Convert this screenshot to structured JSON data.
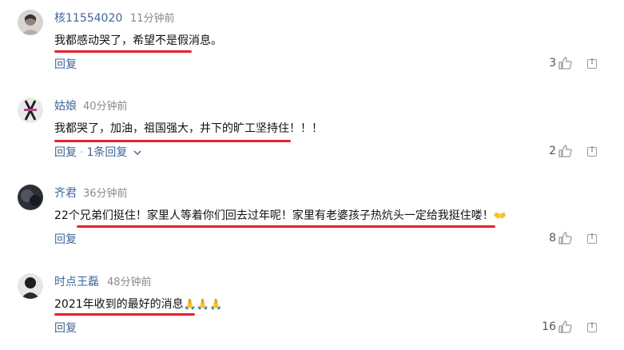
{
  "comments": [
    {
      "username": "核11554020",
      "time": "11分钟前",
      "text": "我都感动哭了，希望不是假消息。",
      "reply_label": "回复",
      "likes": "3"
    },
    {
      "username": "姑娘",
      "time": "40分钟前",
      "text": "我都哭了，加油，祖国强大，井下的旷工坚持住！！！",
      "reply_label": "回复",
      "sub_replies": "1条回复",
      "likes": "2"
    },
    {
      "username": "齐君",
      "time": "36分钟前",
      "text": "22个兄弟们挺住！家里人等着你们回去过年呢！家里有老婆孩子热炕头一定给我挺住喽！",
      "emoji": "👐",
      "reply_label": "回复",
      "likes": "8"
    },
    {
      "username": "时点王磊",
      "time": "48分钟前",
      "text": "2021年收到的最好的消息",
      "emoji": "🙏🙏🙏",
      "reply_label": "回复",
      "likes": "16"
    }
  ],
  "colors": {
    "username": "#406599",
    "highlight": "#e8222e",
    "time": "#8a8a8a"
  },
  "icons": {
    "like": "thumbs-up-icon",
    "report": "report-flag-icon",
    "expand": "chevron-down-icon"
  }
}
